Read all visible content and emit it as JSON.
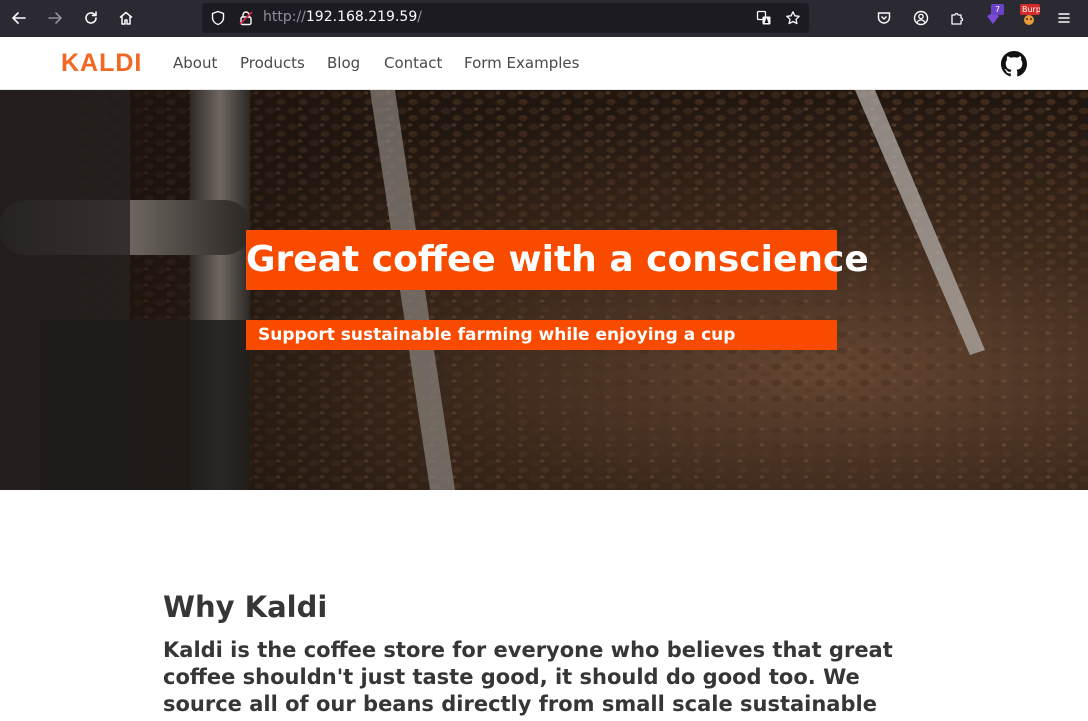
{
  "browser": {
    "url_scheme": "http://",
    "url_host": "192.168.219.59",
    "url_path": "/",
    "extension_badge_count": "7",
    "extension2_badge": "Burp"
  },
  "site": {
    "logo": "KALDI",
    "nav": [
      "About",
      "Products",
      "Blog",
      "Contact",
      "Form Examples"
    ],
    "accent": "#f26722",
    "hero_accent": "#f94b00"
  },
  "hero": {
    "title": "Great coffee with a conscience",
    "subtitle": "Support sustainable farming while enjoying a cup"
  },
  "why": {
    "title": "Why Kaldi",
    "text": "Kaldi is the coffee store for everyone who believes that great coffee shouldn't just taste good, it should do good too. We source all of our beans directly from small scale sustainable farmers and make sure"
  }
}
